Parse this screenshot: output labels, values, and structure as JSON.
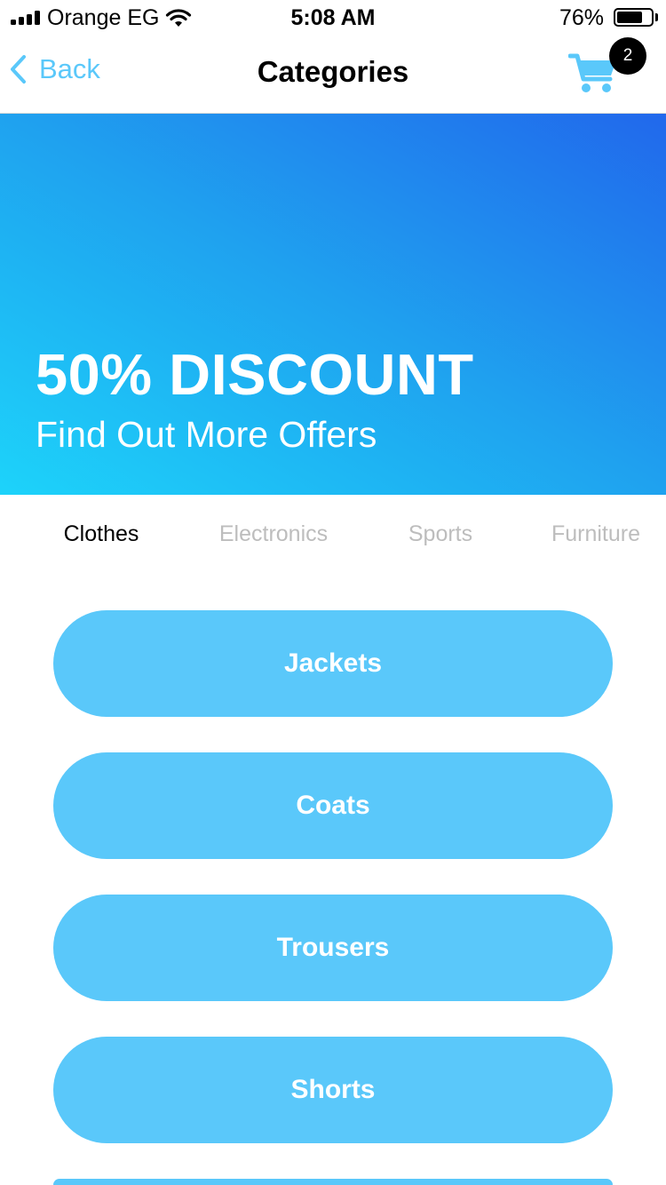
{
  "status_bar": {
    "carrier": "Orange EG",
    "time": "5:08 AM",
    "battery_percent": "76%",
    "battery_level": 0.76,
    "icons": [
      "cellular-signal-icon",
      "wifi-icon",
      "battery-icon"
    ]
  },
  "nav": {
    "back_label": "Back",
    "title": "Categories",
    "cart_badge": "2",
    "icons": [
      "chevron-left-icon",
      "shopping-cart-icon"
    ]
  },
  "banner": {
    "headline": "50% DISCOUNT",
    "subtitle": "Find Out More Offers"
  },
  "tabs": [
    {
      "label": "Clothes",
      "active": true
    },
    {
      "label": "Electronics",
      "active": false
    },
    {
      "label": "Sports",
      "active": false
    },
    {
      "label": "Furniture",
      "active": false
    }
  ],
  "subcategories": [
    {
      "label": "Jackets"
    },
    {
      "label": "Coats"
    },
    {
      "label": "Trousers"
    },
    {
      "label": "Shorts"
    },
    {
      "label": ""
    }
  ],
  "colors": {
    "accent": "#5ac8fa",
    "banner_gradient": [
      "#1dd3fa",
      "#1fa2ef",
      "#2168ec"
    ],
    "tab_inactive": "#bdbdbd"
  }
}
